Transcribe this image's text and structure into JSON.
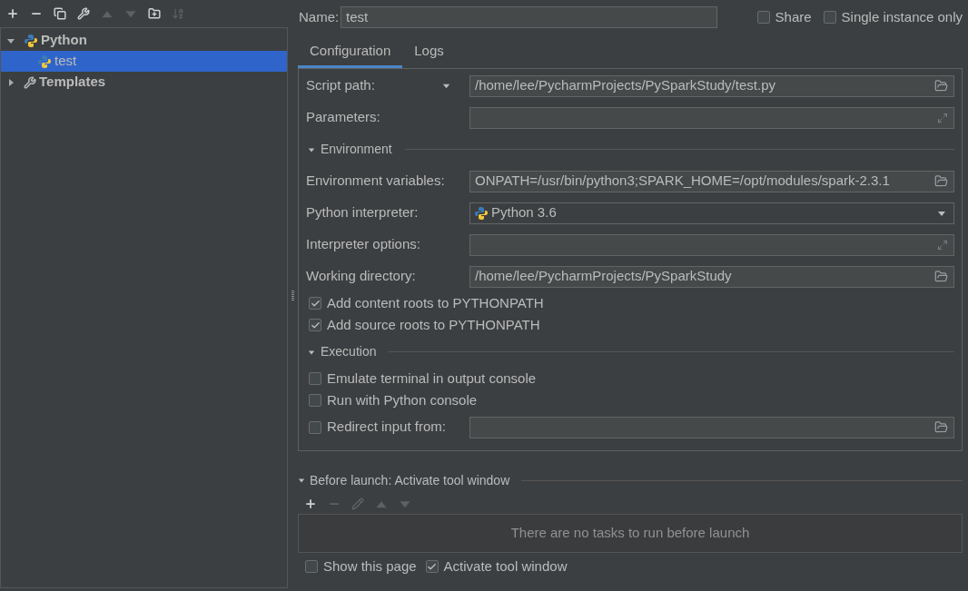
{
  "toolbar": [
    {
      "kind": "add",
      "disabled": false
    },
    {
      "kind": "remove",
      "disabled": false
    },
    {
      "kind": "copy",
      "disabled": false
    },
    {
      "kind": "edit",
      "disabled": false
    },
    {
      "kind": "up",
      "disabled": true
    },
    {
      "kind": "down",
      "disabled": true
    },
    {
      "kind": "folder",
      "disabled": false
    },
    {
      "kind": "sort",
      "disabled": true
    }
  ],
  "tree": [
    {
      "label": "Python",
      "kind": "python",
      "expanded": true,
      "selected": false,
      "children": [
        {
          "label": "test",
          "kind": "python",
          "selected": true
        }
      ]
    },
    {
      "label": "Templates",
      "kind": "wrench",
      "expanded": false,
      "selected": false
    }
  ],
  "name": {
    "label": "Name:",
    "value": "test"
  },
  "options": [
    {
      "label": "Share",
      "checked": false
    },
    {
      "label": "Single instance only",
      "checked": false
    }
  ],
  "tabs": [
    {
      "label": "Configuration",
      "selected": true
    },
    {
      "label": "Logs",
      "selected": false
    }
  ],
  "config": [
    {
      "kind": "field",
      "label": "Script path:",
      "caret": true,
      "value": "/home/lee/PycharmProjects/PySparkStudy/test.py",
      "button": {
        "kind": "folder"
      }
    },
    {
      "kind": "field",
      "label": "Parameters:",
      "button": {
        "kind": "expand"
      }
    },
    {
      "kind": "section",
      "label": "Environment",
      "expanded": true
    },
    {
      "kind": "field",
      "label": "Environment variables:",
      "value": "ONPATH=/usr/bin/python3;SPARK_HOME=/opt/modules/spark-2.3.1",
      "button": {
        "kind": "folder"
      }
    },
    {
      "kind": "select",
      "label": "Python interpreter:",
      "value": "Python 3.6"
    },
    {
      "kind": "field",
      "label": "Interpreter options:",
      "button": {
        "kind": "expand"
      }
    },
    {
      "kind": "field",
      "label": "Working directory:",
      "value": "/home/lee/PycharmProjects/PySparkStudy",
      "button": {
        "kind": "folder"
      }
    },
    {
      "kind": "checkbox",
      "label": "Add content roots to PYTHONPATH",
      "checked": true
    },
    {
      "kind": "checkbox",
      "label": "Add source roots to PYTHONPATH",
      "checked": true
    },
    {
      "kind": "section",
      "label": "Execution",
      "expanded": true
    },
    {
      "kind": "checkbox",
      "label": "Emulate terminal in output console",
      "checked": false
    },
    {
      "kind": "checkbox",
      "label": "Run with Python console",
      "checked": false
    },
    {
      "kind": "checkbox_field",
      "label": "Redirect input from:",
      "checked": false,
      "button": {
        "kind": "folder"
      }
    }
  ],
  "before_launch": {
    "title": "Before launch: Activate tool window",
    "expanded": true,
    "tools": [
      {
        "kind": "add",
        "disabled": false
      },
      {
        "kind": "remove",
        "disabled": true
      },
      {
        "kind": "edit",
        "disabled": true
      },
      {
        "kind": "up",
        "disabled": true
      },
      {
        "kind": "down",
        "disabled": true
      }
    ],
    "empty_text": "There are no tasks to run before launch"
  },
  "footer": [
    {
      "label": "Show this page",
      "checked": false
    },
    {
      "label": "Activate tool window",
      "checked": true
    }
  ]
}
